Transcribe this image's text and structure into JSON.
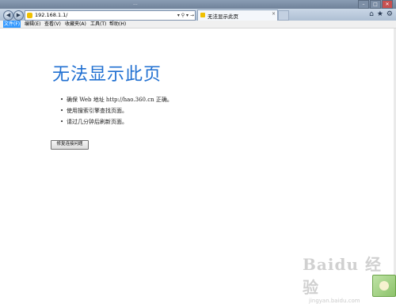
{
  "window": {
    "title": "...",
    "buttons": [
      "–",
      "□",
      "✕"
    ]
  },
  "navbar": {
    "address": "192.168.1.1/",
    "address_tools": "▾ ⚲ ▾ →",
    "tab_title": "无法显示此页",
    "tab_close": "×"
  },
  "menu": {
    "items": [
      "文件(F)",
      "编辑(E)",
      "查看(V)",
      "收藏夹(A)",
      "工具(T)",
      "帮助(H)"
    ]
  },
  "page": {
    "title": "无法显示此页",
    "bullets": [
      "确保 Web 地址 http://hao.360.cn 正确。",
      "使用搜索引擎查找页面。",
      "请过几分钟后刷新页面。"
    ],
    "fix_button": "修复连接问题"
  },
  "icons": {
    "back": "back-arrow-icon",
    "forward": "forward-arrow-icon",
    "home": "home-icon",
    "favorites": "star-icon",
    "settings": "gear-icon"
  },
  "watermark": {
    "text": "Baidu 经验",
    "sub": "jingyan.baidu.com"
  },
  "colors": {
    "title_blue": "#1f6fd1",
    "menu_active": "#3399ff"
  }
}
